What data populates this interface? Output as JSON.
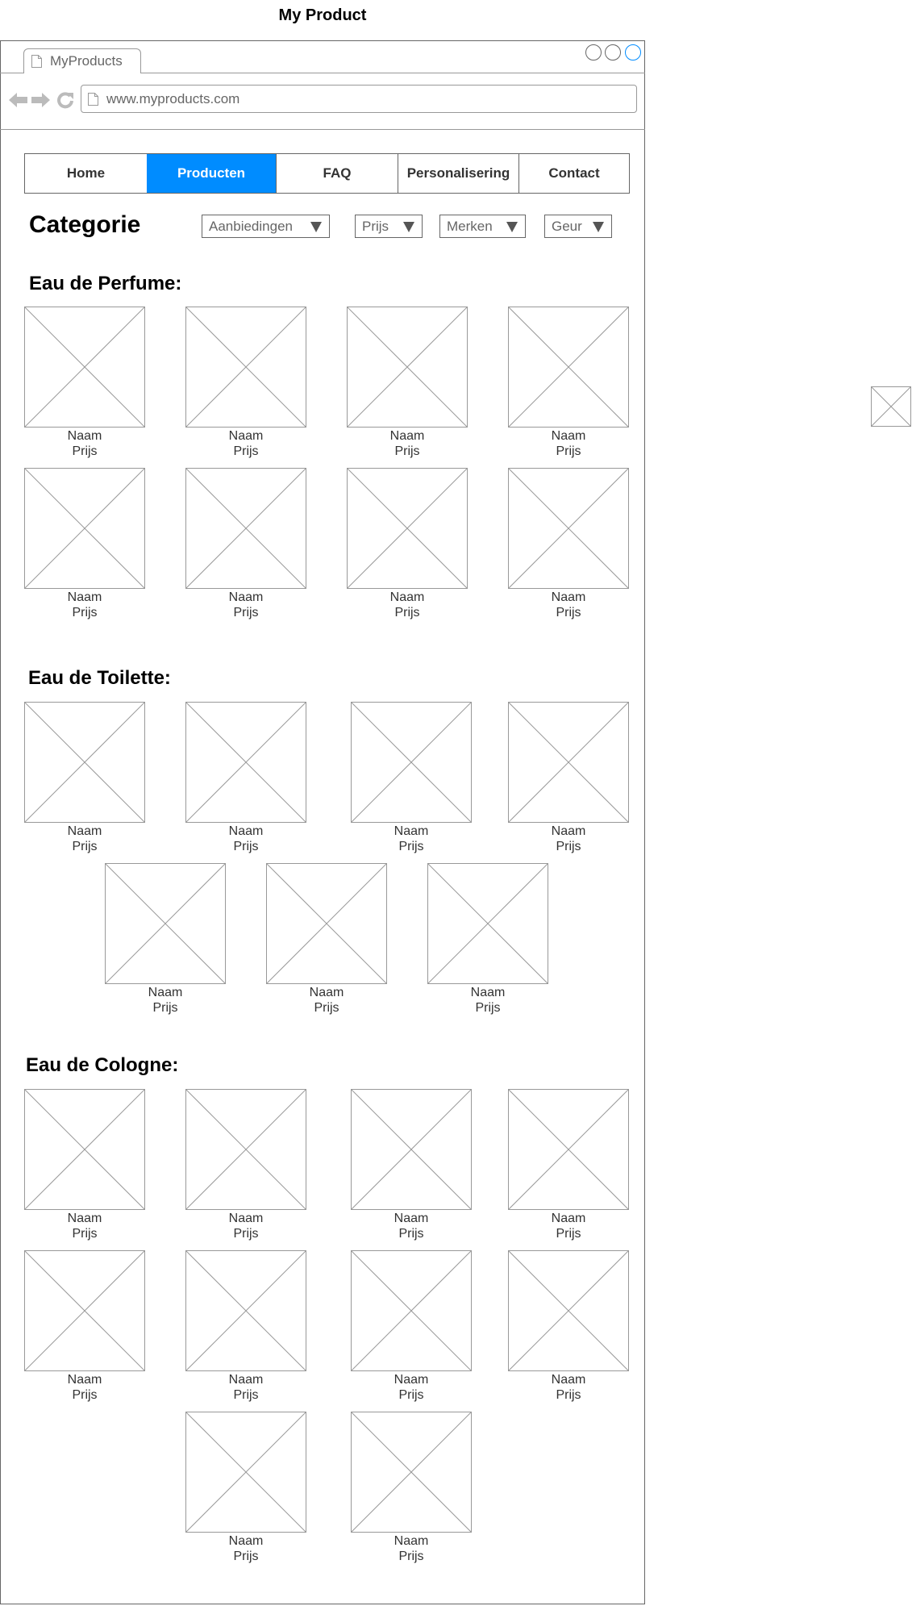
{
  "page_title": "My Product",
  "browser": {
    "tab_label": "MyProducts",
    "url": "www.myproducts.com",
    "icons": [
      "page-icon",
      "back-arrow-icon",
      "forward-arrow-icon",
      "reload-icon",
      "window-buttons"
    ]
  },
  "menu": {
    "active": "Producten",
    "items": [
      {
        "label": "Home"
      },
      {
        "label": "Producten"
      },
      {
        "label": "FAQ"
      },
      {
        "label": "Personalisering"
      },
      {
        "label": "Contact"
      }
    ]
  },
  "filters": {
    "heading": "Categorie",
    "selects": [
      {
        "label": "Aanbiedingen"
      },
      {
        "label": "Prijs"
      },
      {
        "label": "Merken"
      },
      {
        "label": "Geur"
      }
    ]
  },
  "item_labels": {
    "name": "Naam",
    "price": "Prijs"
  },
  "sections": [
    {
      "title": "Eau de Perfume:",
      "item_count": 8
    },
    {
      "title": "Eau de Toilette:",
      "item_count": 7
    },
    {
      "title": "Eau de Cologne:",
      "item_count": 10
    }
  ],
  "colors": {
    "accent": "#008cff",
    "border": "#666666",
    "placeholder": "#999999"
  }
}
